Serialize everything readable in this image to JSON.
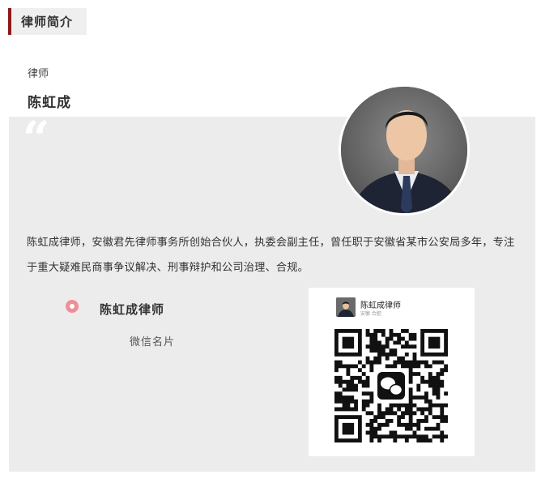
{
  "section": {
    "title": "律师简介"
  },
  "profile": {
    "role": "律师",
    "name": "陈虹成",
    "quote_mark": "“",
    "bio": "陈虹成律师，安徽君先律师事务所创始合伙人，执委会副主任，曾任职于安徽省某市公安局多年，专注于重大疑难民商事争议解决、刑事辩护和公司治理、合规。"
  },
  "wechat": {
    "name": "陈虹成律师",
    "card_label": "微信名片",
    "qr_card": {
      "name": "陈虹成律师",
      "subtitle": "安徽 合肥",
      "icon": "wechat-icon"
    }
  },
  "colors": {
    "accent_bar": "#8b1a1a",
    "panel_bg": "#ececec",
    "bullet": "#f08e96"
  }
}
